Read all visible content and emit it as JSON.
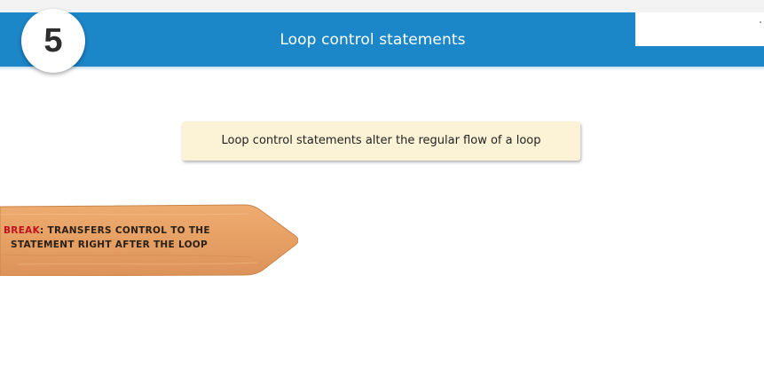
{
  "header": {
    "step_number": "5",
    "title": "Loop control statements"
  },
  "callout": {
    "text": "Loop control statements alter the regular flow of a loop"
  },
  "sign": {
    "keyword": "BREAK",
    "line1_rest": ": TRANSFERS CONTROL TO THE",
    "line2": "STATEMENT RIGHT AFTER THE LOOP"
  },
  "colors": {
    "header_blue": "#1b86c8",
    "callout_bg": "#fcf3d6",
    "wood": "#e9a467",
    "keyword_red": "#c1121f"
  }
}
